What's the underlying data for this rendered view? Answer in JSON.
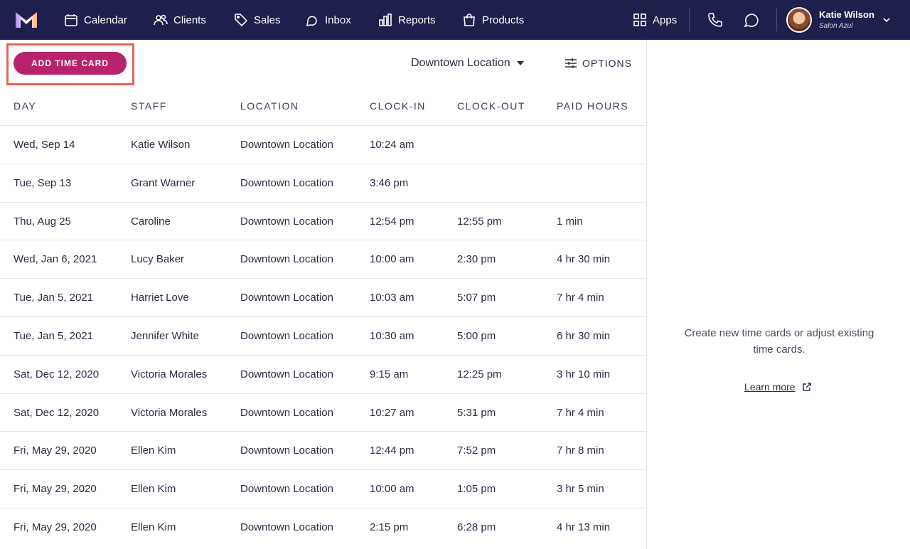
{
  "nav": {
    "items": [
      {
        "label": "Calendar",
        "icon": "calendar-icon"
      },
      {
        "label": "Clients",
        "icon": "clients-icon"
      },
      {
        "label": "Sales",
        "icon": "tag-icon"
      },
      {
        "label": "Inbox",
        "icon": "inbox-icon"
      },
      {
        "label": "Reports",
        "icon": "reports-icon"
      },
      {
        "label": "Products",
        "icon": "bag-icon"
      }
    ],
    "apps_label": "Apps",
    "user": {
      "name": "Katie Wilson",
      "business": "Salon Azul"
    }
  },
  "toolbar": {
    "add_label": "ADD TIME CARD",
    "location": "Downtown Location",
    "options_label": "OPTIONS"
  },
  "table": {
    "headers": [
      "DAY",
      "STAFF",
      "LOCATION",
      "CLOCK-IN",
      "CLOCK-OUT",
      "PAID HOURS"
    ],
    "rows": [
      {
        "day": "Wed, Sep 14",
        "staff": "Katie Wilson",
        "location": "Downtown Location",
        "in": "10:24 am",
        "out": "",
        "paid": ""
      },
      {
        "day": "Tue, Sep 13",
        "staff": "Grant Warner",
        "location": "Downtown Location",
        "in": "3:46 pm",
        "out": "",
        "paid": ""
      },
      {
        "day": "Thu, Aug 25",
        "staff": "Caroline",
        "location": "Downtown Location",
        "in": "12:54 pm",
        "out": "12:55 pm",
        "paid": "1 min"
      },
      {
        "day": "Wed, Jan 6, 2021",
        "staff": "Lucy Baker",
        "location": "Downtown Location",
        "in": "10:00 am",
        "out": "2:30 pm",
        "paid": "4 hr 30 min"
      },
      {
        "day": "Tue, Jan 5, 2021",
        "staff": "Harriet Love",
        "location": "Downtown Location",
        "in": "10:03 am",
        "out": "5:07 pm",
        "paid": "7 hr 4 min"
      },
      {
        "day": "Tue, Jan 5, 2021",
        "staff": "Jennifer White",
        "location": "Downtown Location",
        "in": "10:30 am",
        "out": "5:00 pm",
        "paid": "6 hr 30 min"
      },
      {
        "day": "Sat, Dec 12, 2020",
        "staff": "Victoria Morales",
        "location": "Downtown Location",
        "in": "9:15 am",
        "out": "12:25 pm",
        "paid": "3 hr 10 min"
      },
      {
        "day": "Sat, Dec 12, 2020",
        "staff": "Victoria Morales",
        "location": "Downtown Location",
        "in": "10:27 am",
        "out": "5:31 pm",
        "paid": "7 hr 4 min"
      },
      {
        "day": "Fri, May 29, 2020",
        "staff": "Ellen Kim",
        "location": "Downtown Location",
        "in": "12:44 pm",
        "out": "7:52 pm",
        "paid": "7 hr 8 min"
      },
      {
        "day": "Fri, May 29, 2020",
        "staff": "Ellen Kim",
        "location": "Downtown Location",
        "in": "10:00 am",
        "out": "1:05 pm",
        "paid": "3 hr 5 min"
      },
      {
        "day": "Fri, May 29, 2020",
        "staff": "Ellen Kim",
        "location": "Downtown Location",
        "in": "2:15 pm",
        "out": "6:28 pm",
        "paid": "4 hr 13 min"
      }
    ]
  },
  "side": {
    "message": "Create new time cards or adjust existing time cards.",
    "link_label": "Learn more"
  },
  "colors": {
    "nav_bg": "#1f1f4d",
    "primary_button": "#b8246c",
    "highlight": "#e5654e"
  }
}
